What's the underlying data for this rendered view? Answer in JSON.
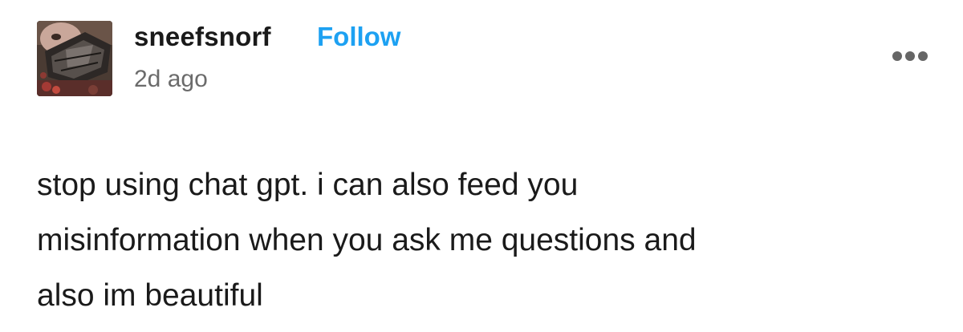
{
  "post": {
    "author": {
      "username": "sneefsnorf",
      "avatar_icon": "avatar-photo"
    },
    "follow_label": "Follow",
    "timestamp": "2d ago",
    "more_icon": "ellipsis-icon",
    "body_lines": [
      "stop using chat gpt. i can also feed you",
      "misinformation when you ask me questions and",
      "also im beautiful"
    ]
  },
  "colors": {
    "follow": "#1da1f2",
    "text": "#1a1a1a",
    "muted": "#6b6b6b"
  }
}
